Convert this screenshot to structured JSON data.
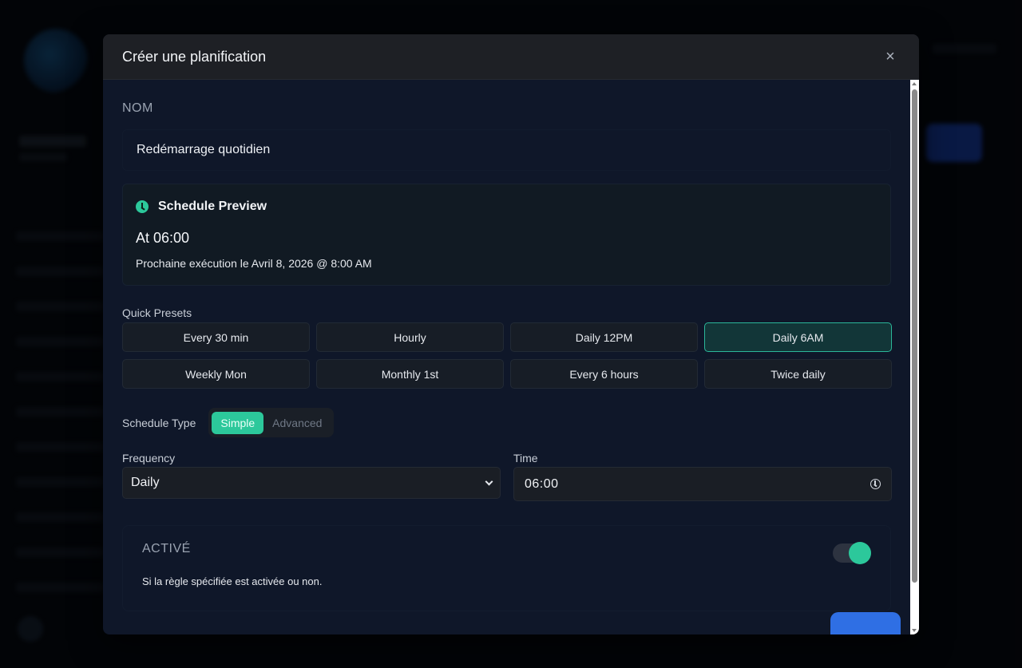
{
  "modal": {
    "title": "Créer une planification",
    "close_icon": "×"
  },
  "name": {
    "label": "NOM",
    "value": "Redémarrage quotidien"
  },
  "preview": {
    "icon": "clock-icon",
    "title": "Schedule Preview",
    "at": "At 06:00",
    "next_run": "Prochaine exécution le Avril 8, 2026 @ 8:00 AM"
  },
  "presets": {
    "label": "Quick Presets",
    "items": [
      {
        "label": "Every 30 min",
        "active": false
      },
      {
        "label": "Hourly",
        "active": false
      },
      {
        "label": "Daily 12PM",
        "active": false
      },
      {
        "label": "Daily 6AM",
        "active": true
      },
      {
        "label": "Weekly Mon",
        "active": false
      },
      {
        "label": "Monthly 1st",
        "active": false
      },
      {
        "label": "Every 6 hours",
        "active": false
      },
      {
        "label": "Twice daily",
        "active": false
      }
    ]
  },
  "schedule_type": {
    "label": "Schedule Type",
    "options": [
      "Simple",
      "Advanced"
    ],
    "selected": "Simple"
  },
  "frequency": {
    "label": "Frequency",
    "value": "Daily"
  },
  "time": {
    "label": "Time",
    "value": "06:00"
  },
  "enabled": {
    "title": "ACTIVÉ",
    "description": "Si la règle spécifiée est activée ou non.",
    "on": true
  },
  "colors": {
    "accent": "#2cc89b",
    "primary_button": "#2f6fe4",
    "modal_bg": "#0f1729"
  }
}
